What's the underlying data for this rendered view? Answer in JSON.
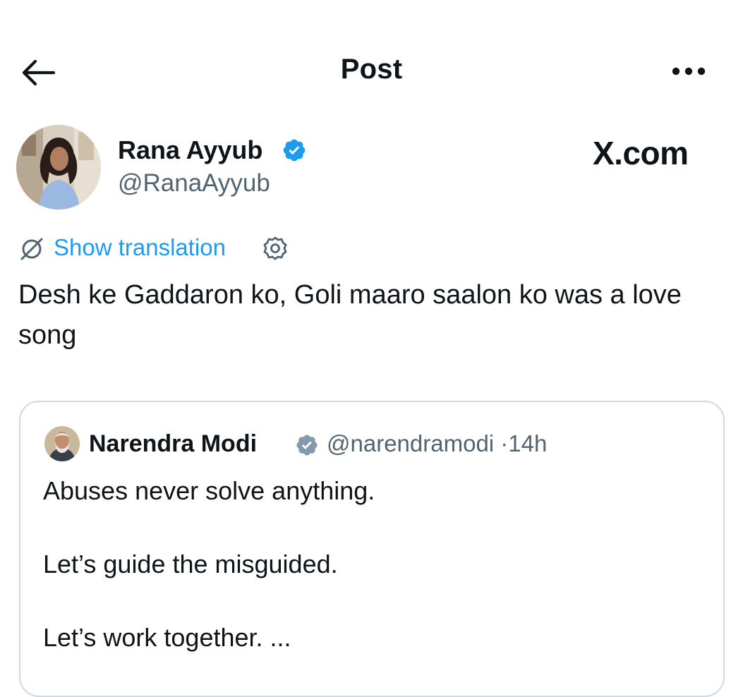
{
  "header": {
    "title": "Post",
    "back_icon": "arrow-left-icon",
    "more_icon": "ellipsis-icon"
  },
  "post": {
    "author_name": "Rana Ayyub",
    "author_handle": "@RanaAyyub",
    "verified": true,
    "watermark": "X.com",
    "show_translation_label": "Show translation",
    "text": "Desh ke Gaddaron ko, Goli maaro saalon ko was a love song"
  },
  "quoted_post": {
    "author_name": "Narendra Modi",
    "author_handle": "@narendramodi",
    "separator": "·",
    "time_ago": "14h",
    "verified_badge_color": "#829aab",
    "paragraphs": [
      "Abuses never solve anything.",
      "Let’s guide the misguided.",
      "Let’s work together. ..."
    ]
  },
  "colors": {
    "accent": "#1d9bf0",
    "text_primary": "#0f1419",
    "text_secondary": "#536471",
    "border": "#cfd9de"
  }
}
